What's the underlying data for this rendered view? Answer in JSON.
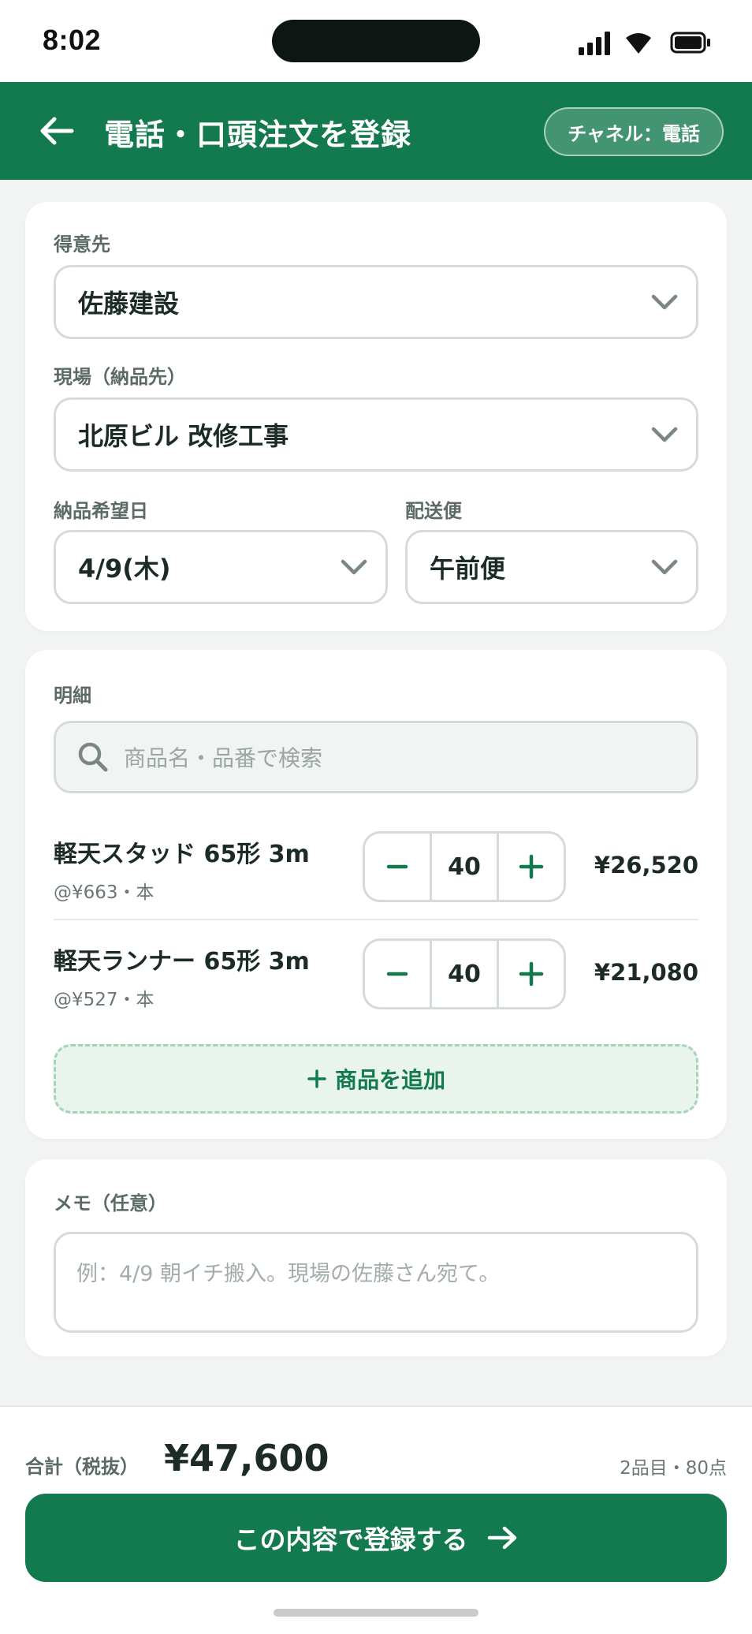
{
  "status_bar": {
    "time": "8:02",
    "icons": [
      "signal-icon",
      "wifi-icon",
      "battery-icon"
    ]
  },
  "header": {
    "title": "電話・口頭注文を登録",
    "channel_badge": "チャネル：電話",
    "back_icon": "arrow-left-icon"
  },
  "order_form": {
    "customer": {
      "label": "得意先",
      "value": "佐藤建設"
    },
    "site": {
      "label": "現場（納品先）",
      "value": "北原ビル 改修工事"
    },
    "delivery_date": {
      "label": "納品希望日",
      "value": "4/9(木)"
    },
    "delivery_slot": {
      "label": "配送便",
      "value": "午前便"
    }
  },
  "line_items": {
    "section_label": "明細",
    "search": {
      "placeholder": "商品名・品番で検索",
      "value": ""
    },
    "items": [
      {
        "name": "軽天スタッド 65形 3m",
        "unit_price": "@¥663・本",
        "quantity": "40",
        "amount": "¥26,520"
      },
      {
        "name": "軽天ランナー 65形 3m",
        "unit_price": "@¥527・本",
        "quantity": "40",
        "amount": "¥21,080"
      }
    ],
    "add_button_label": "商品を追加"
  },
  "memo": {
    "label": "メモ（任意）",
    "placeholder": "例：4/9 朝イチ搬入。現場の佐藤さん宛て。",
    "value": ""
  },
  "footer": {
    "total_label": "合計（税抜）",
    "total_value": "¥47,600",
    "count_summary": "2品目・80点",
    "submit_label": "この内容で登録する"
  },
  "colors": {
    "brand": "#137a4f",
    "background": "#f2f4f3",
    "card": "#ffffff",
    "add_button_bg": "#e8f4ec"
  }
}
